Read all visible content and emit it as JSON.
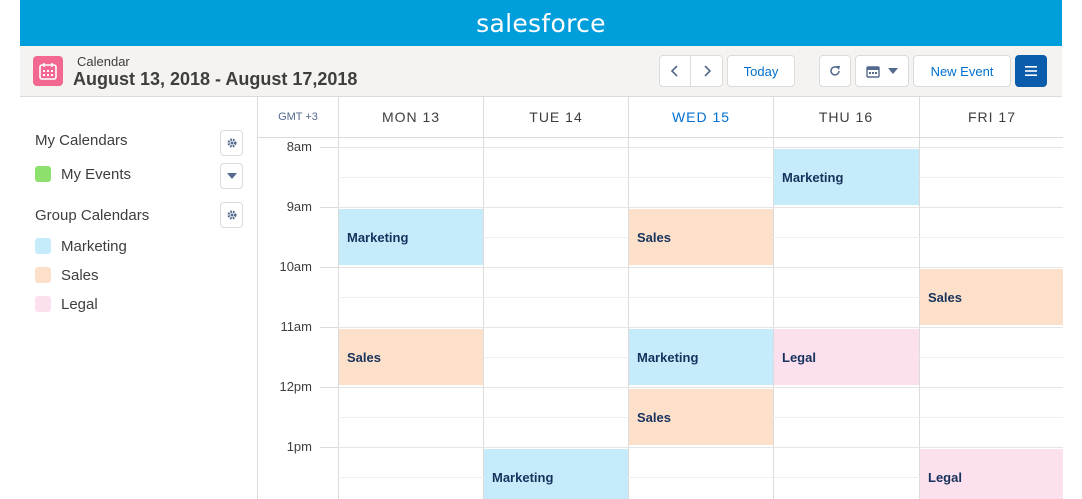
{
  "brand": "salesforce",
  "header": {
    "label": "Calendar",
    "title": "August 13, 2018 - August 17,2018",
    "today_label": "Today",
    "new_event_label": "New Event"
  },
  "sidebar": {
    "my_calendars_title": "My Calendars",
    "my_calendars": [
      {
        "label": "My Events",
        "color": "#8ee06d"
      }
    ],
    "group_calendars_title": "Group Calendars",
    "group_calendars": [
      {
        "label": "Marketing",
        "color": "#c6ecfb"
      },
      {
        "label": "Sales",
        "color": "#fde0c9"
      },
      {
        "label": "Legal",
        "color": "#fce0ee"
      }
    ]
  },
  "grid": {
    "timezone": "GMT +3",
    "days": [
      {
        "label": "MON 13",
        "today": false
      },
      {
        "label": "TUE 14",
        "today": false
      },
      {
        "label": "WED 15",
        "today": true
      },
      {
        "label": "THU 16",
        "today": false
      },
      {
        "label": "FRI 17",
        "today": false
      }
    ],
    "hours": [
      "8am",
      "9am",
      "10am",
      "11am",
      "12pm",
      "1pm"
    ]
  },
  "events": [
    {
      "title": "Marketing",
      "calendar": "Marketing",
      "day": "THU 16",
      "start": "8:00",
      "end": "9:00"
    },
    {
      "title": "Marketing",
      "calendar": "Marketing",
      "day": "MON 13",
      "start": "9:00",
      "end": "10:00"
    },
    {
      "title": "Sales",
      "calendar": "Sales",
      "day": "WED 15",
      "start": "9:00",
      "end": "10:00"
    },
    {
      "title": "Sales",
      "calendar": "Sales",
      "day": "FRI 17",
      "start": "10:00",
      "end": "11:00"
    },
    {
      "title": "Sales",
      "calendar": "Sales",
      "day": "MON 13",
      "start": "11:00",
      "end": "12:00"
    },
    {
      "title": "Marketing",
      "calendar": "Marketing",
      "day": "WED 15",
      "start": "11:00",
      "end": "12:00"
    },
    {
      "title": "Legal",
      "calendar": "Legal",
      "day": "THU 16",
      "start": "11:00",
      "end": "12:00"
    },
    {
      "title": "Sales",
      "calendar": "Sales",
      "day": "WED 15",
      "start": "12:00",
      "end": "13:00"
    },
    {
      "title": "Marketing",
      "calendar": "Marketing",
      "day": "TUE 14",
      "start": "13:00",
      "end": "14:00"
    },
    {
      "title": "Legal",
      "calendar": "Legal",
      "day": "FRI 17",
      "start": "13:00",
      "end": "14:00"
    }
  ]
}
